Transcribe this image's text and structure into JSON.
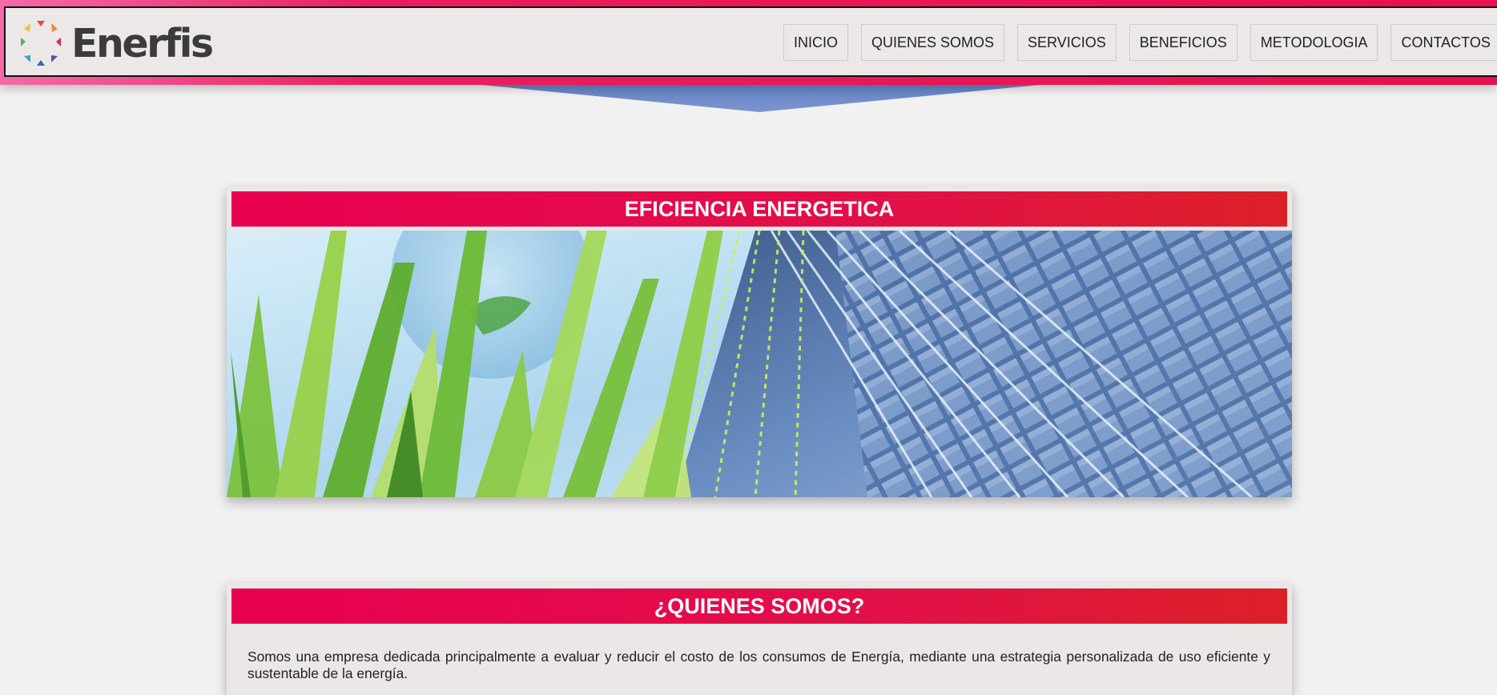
{
  "brand": {
    "name": "Enerfis",
    "logo_colors": [
      "#e34b4d",
      "#f08a3a",
      "#f3c23b",
      "#4cb851",
      "#2fa9c5",
      "#3366b8",
      "#6a4aa3",
      "#d5266b"
    ]
  },
  "nav": {
    "items": [
      {
        "label": "INICIO"
      },
      {
        "label": "QUIENES SOMOS"
      },
      {
        "label": "SERVICIOS"
      },
      {
        "label": "BENEFICIOS"
      },
      {
        "label": "METODOLOGIA"
      },
      {
        "label": "CONTACTOS"
      }
    ]
  },
  "hero": {
    "title": "EFICIENCIA ENERGETICA",
    "image": "green-grass-and-glass-building-image"
  },
  "about": {
    "title": "¿QUIENES SOMOS?",
    "text": "Somos una empresa dedicada principalmente a evaluar y reducir el costo de los consumos de Energía, mediante una estrategia personalizada de uso eficiente y sustentable de la energía."
  },
  "colors": {
    "accent": "#e8004f",
    "accent_end": "#dc2028",
    "header_pink": "#f56aa8",
    "arrow_blue": "#6b86c6",
    "background": "#f2f1f1"
  }
}
